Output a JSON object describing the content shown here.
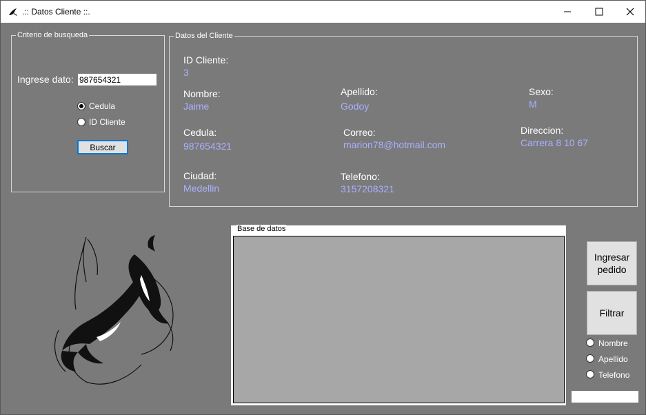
{
  "window": {
    "title": ".:: Datos Cliente ::.",
    "minimize_glyph": "—",
    "maximize_glyph": "☐",
    "close_glyph": "✕"
  },
  "search": {
    "legend": "Criterio de busqueda",
    "prompt": "Ingrese dato:",
    "input_value": "987654321",
    "options": [
      "Cedula",
      "ID Cliente"
    ],
    "selected": "Cedula",
    "button": "Buscar"
  },
  "client": {
    "legend": "Datos del Cliente",
    "id_label": "ID Cliente:",
    "id_value": "3",
    "nombre_label": "Nombre:",
    "nombre_value": "Jaime",
    "apellido_label": "Apellido:",
    "apellido_value": "Godoy",
    "sexo_label": "Sexo:",
    "sexo_value": "M",
    "cedula_label": "Cedula:",
    "cedula_value": "987654321",
    "correo_label": "Correo:",
    "correo_value": "marion78@hotmail.com",
    "direccion_label": "Direccion:",
    "direccion_value": "Carrera 8 10 67",
    "ciudad_label": "Ciudad:",
    "ciudad_value": "Medellin",
    "telefono_label": "Telefono:",
    "telefono_value": "3157208321"
  },
  "database": {
    "legend": "Base de datos"
  },
  "actions": {
    "ingresar_line1": "Ingresar",
    "ingresar_line2": "pedido",
    "filtrar": "Filtrar",
    "filter_options": [
      "Nombre",
      "Apellido",
      "Telefono"
    ],
    "filter_input_value": ""
  },
  "icons": {
    "app": "orca-icon",
    "logo": "orca-logo"
  }
}
